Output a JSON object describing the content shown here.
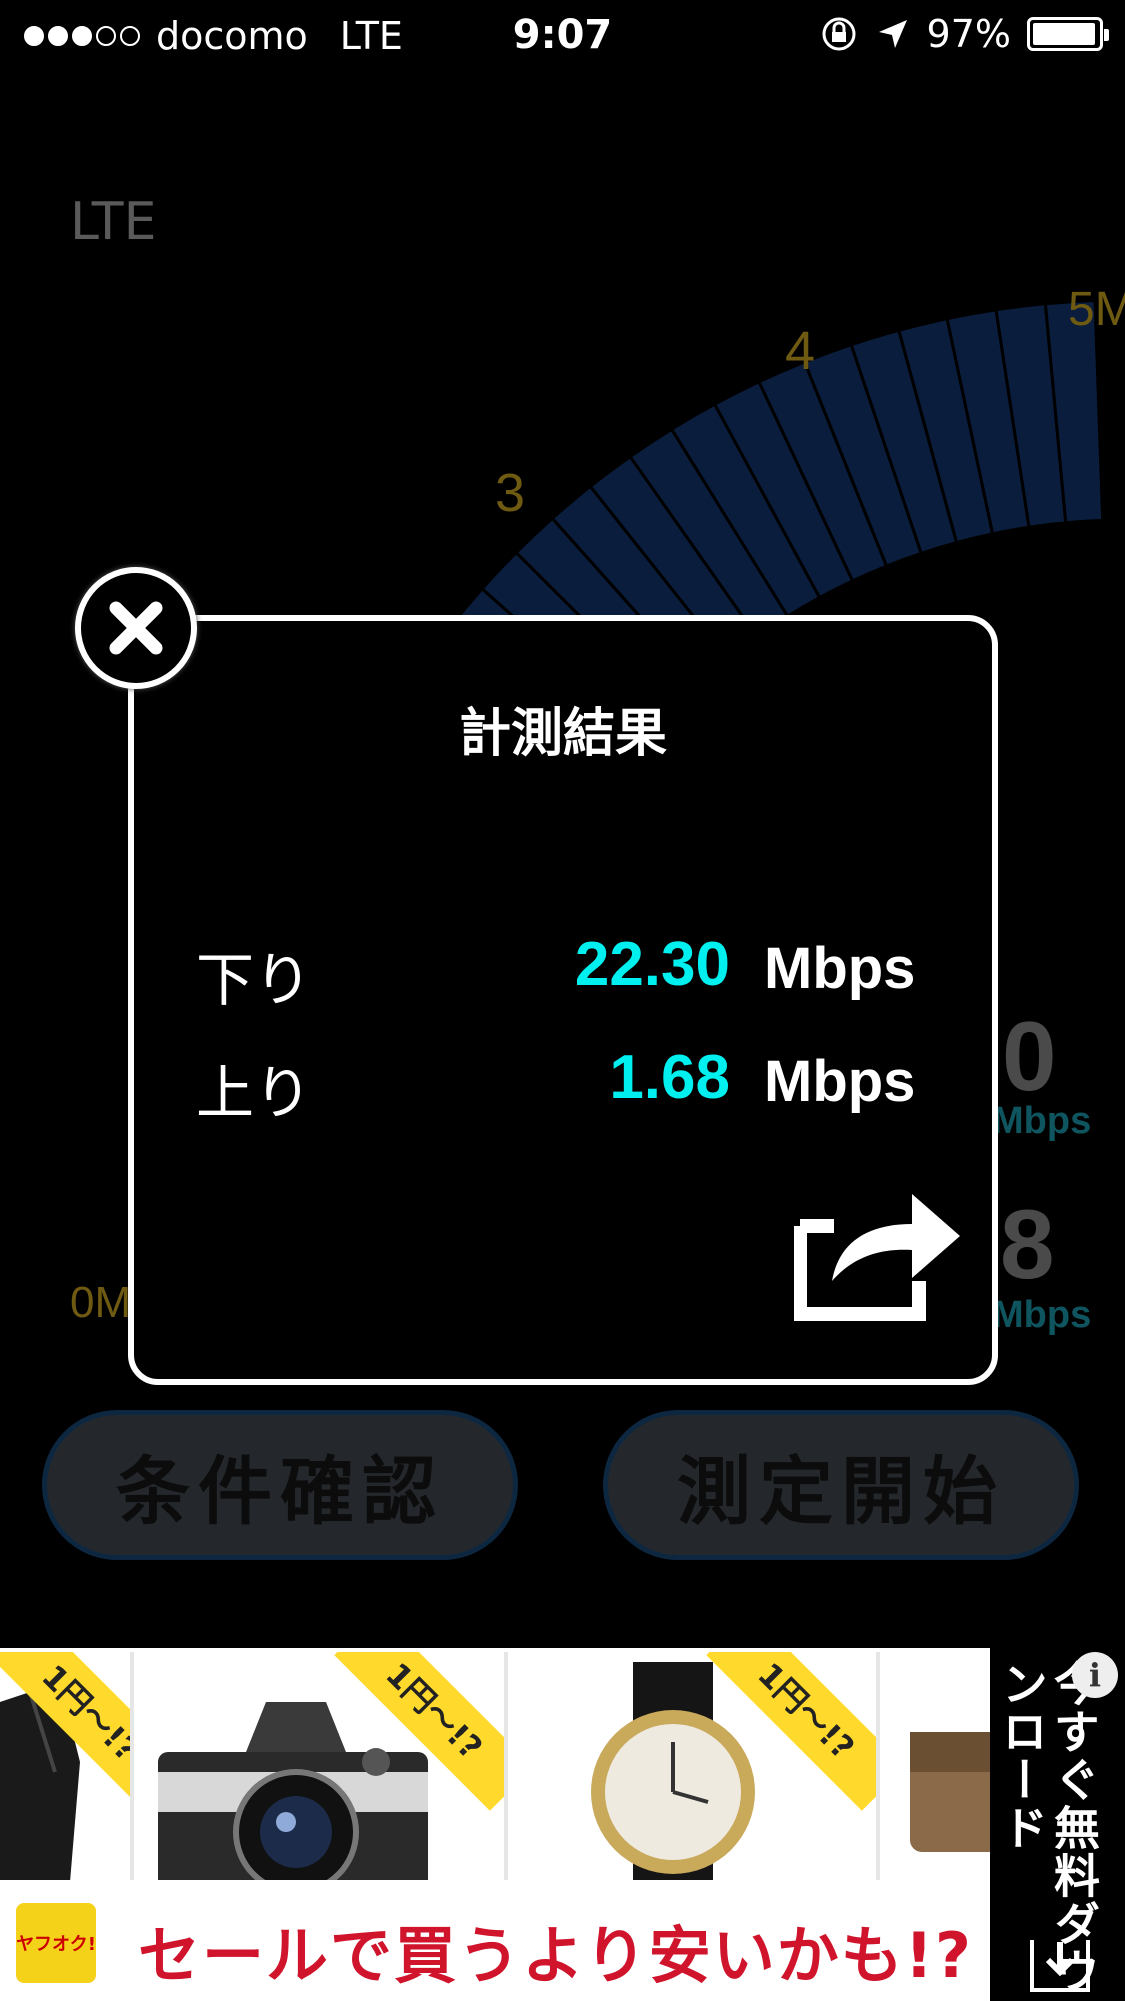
{
  "status_bar": {
    "carrier": "docomo",
    "network": "LTE",
    "time": "9:07",
    "battery": "97%",
    "battery_level": 0.97,
    "signal_bars_filled": 3,
    "signal_bars_total": 5
  },
  "background": {
    "network_type": "LTE",
    "gauge_labels": [
      "0M",
      "3",
      "4",
      "5M"
    ],
    "download_value_partial": "0",
    "upload_value_partial": "8",
    "unit": "Mbps",
    "conditions_button": "条件確認",
    "start_button": "測定開始"
  },
  "modal": {
    "title": "計測結果",
    "download_label": "下り",
    "download_value": "22.30",
    "download_unit": "Mbps",
    "upload_label": "上り",
    "upload_value": "1.68",
    "upload_unit": "Mbps"
  },
  "ad": {
    "badge_text": "1円〜!?",
    "headline": "セールで買うより安いかも!?",
    "brand": "ヤフオク!",
    "side_text": "今すぐ無料ダウンロード"
  },
  "colors": {
    "value_accent": "#00f0f0",
    "gauge_blue": "#0b1d3d",
    "ad_badge": "#ffd92c",
    "ad_headline": "#d0142c"
  },
  "icons": {
    "close": "close-icon",
    "share": "share-icon",
    "orientation_lock": "rotation-lock-icon",
    "location": "location-arrow-icon",
    "info": "info-icon",
    "download": "download-icon"
  }
}
